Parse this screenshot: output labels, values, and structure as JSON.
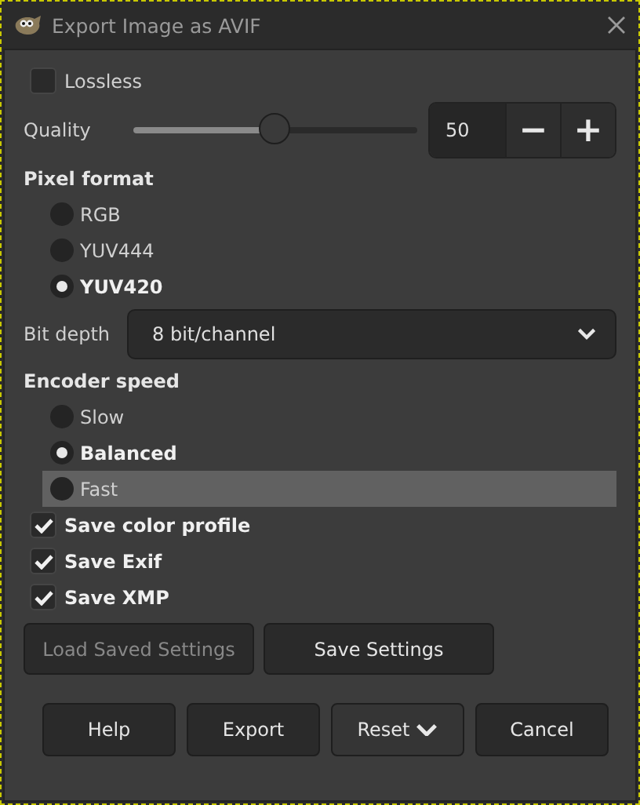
{
  "window": {
    "title": "Export Image as AVIF"
  },
  "lossless": {
    "label": "Lossless",
    "checked": false
  },
  "quality": {
    "label": "Quality",
    "level": 0.5,
    "value": "50",
    "decrement": "−",
    "increment": "+"
  },
  "pixel_format": {
    "heading": "Pixel format",
    "options": [
      {
        "label": "RGB",
        "selected": false,
        "highlighted": false
      },
      {
        "label": "YUV444",
        "selected": false,
        "highlighted": false
      },
      {
        "label": "YUV420",
        "selected": true,
        "highlighted": false
      }
    ]
  },
  "bit_depth": {
    "label": "Bit depth",
    "value": "8 bit/channel"
  },
  "encoder_speed": {
    "heading": "Encoder speed",
    "options": [
      {
        "label": "Slow",
        "selected": false,
        "highlighted": false
      },
      {
        "label": "Balanced",
        "selected": true,
        "highlighted": false
      },
      {
        "label": "Fast",
        "selected": false,
        "highlighted": true
      }
    ]
  },
  "metadata": [
    {
      "label": "Save color profile",
      "checked": true
    },
    {
      "label": "Save Exif",
      "checked": true
    },
    {
      "label": "Save XMP",
      "checked": true
    }
  ],
  "settings_buttons": [
    {
      "label": "Load Saved Settings",
      "disabled": true
    },
    {
      "label": "Save Settings",
      "disabled": false
    }
  ],
  "buttons": [
    {
      "label": "Help",
      "kind": "plain"
    },
    {
      "label": "Export",
      "kind": "plain"
    },
    {
      "label": "Reset",
      "kind": "menu"
    },
    {
      "label": "Cancel",
      "kind": "plain"
    }
  ]
}
